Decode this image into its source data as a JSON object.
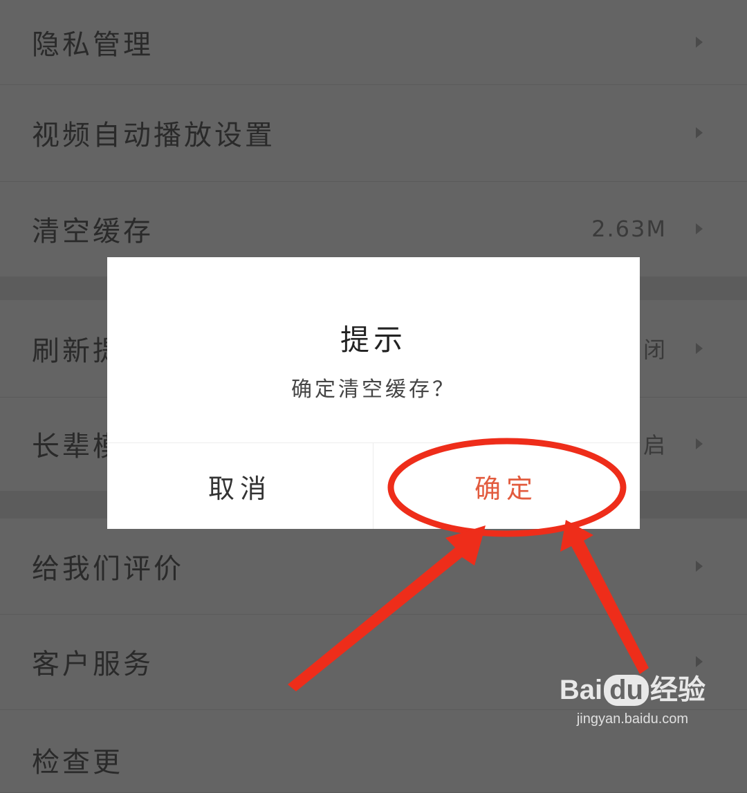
{
  "settings": {
    "items": [
      {
        "label": "隐私管理",
        "value": ""
      },
      {
        "label": "视频自动播放设置",
        "value": ""
      },
      {
        "label": "清空缓存",
        "value": "2.63M"
      },
      {
        "label": "刷新提",
        "value": "闭"
      },
      {
        "label": "长辈模",
        "value": "启"
      },
      {
        "label": "给我们评价",
        "value": ""
      },
      {
        "label": "客户服务",
        "value": ""
      },
      {
        "label": "检查更",
        "value": ""
      }
    ]
  },
  "dialog": {
    "title": "提示",
    "message": "确定清空缓存？",
    "cancel_label": "取消",
    "confirm_label": "确定"
  },
  "watermark": {
    "logo_prefix": "Bai",
    "logo_du": "du",
    "logo_suffix": "经验",
    "url": "jingyan.baidu.com"
  },
  "colors": {
    "overlay_bg": "#646464",
    "dialog_bg": "#ffffff",
    "confirm_text": "#e25b3e",
    "annotation": "#ee2d1a"
  },
  "icons": {
    "row_arrow": "chevron-right-icon"
  }
}
